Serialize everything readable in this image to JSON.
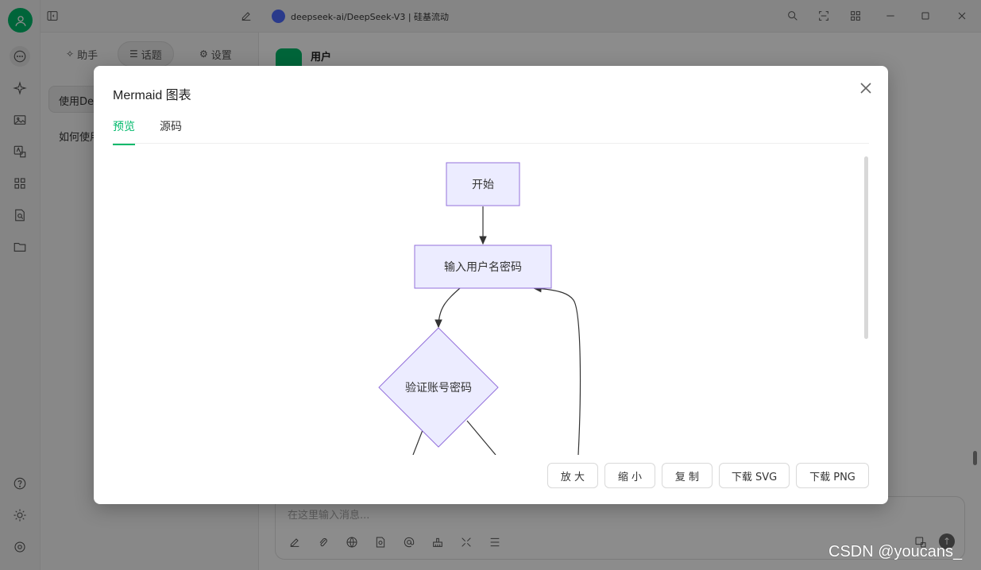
{
  "sidebar": {
    "tabs": [
      {
        "glyph": "✧",
        "label": "助手"
      },
      {
        "glyph": "☰",
        "label": "话题"
      },
      {
        "glyph": "⚙",
        "label": "设置"
      }
    ],
    "topics": [
      "使用Dee",
      "如何使用"
    ]
  },
  "titlebar": {
    "model_title": "deepseek-ai/DeepSeek-V3 | 硅基流动"
  },
  "chat": {
    "user_name": "用户",
    "input_placeholder": "在这里输入消息...",
    "send_glyph": "↑"
  },
  "modal": {
    "title": "Mermaid 图表",
    "tabs": [
      "预览",
      "源码"
    ],
    "buttons": {
      "zoom_in": "放 大",
      "zoom_out": "缩 小",
      "copy": "复 制",
      "download_svg": "下载 SVG",
      "download_png": "下载 PNG"
    }
  },
  "diagram": {
    "nodes": {
      "start": "开始",
      "input": "输入用户名密码",
      "verify": "验证账号密码"
    },
    "colors": {
      "fill": "#ececff",
      "stroke": "#9370db",
      "edge": "#333333"
    }
  },
  "watermark": "CSDN @youcans_",
  "colors": {
    "accent": "#00b96b",
    "deepseek": "#4d6bfe"
  }
}
